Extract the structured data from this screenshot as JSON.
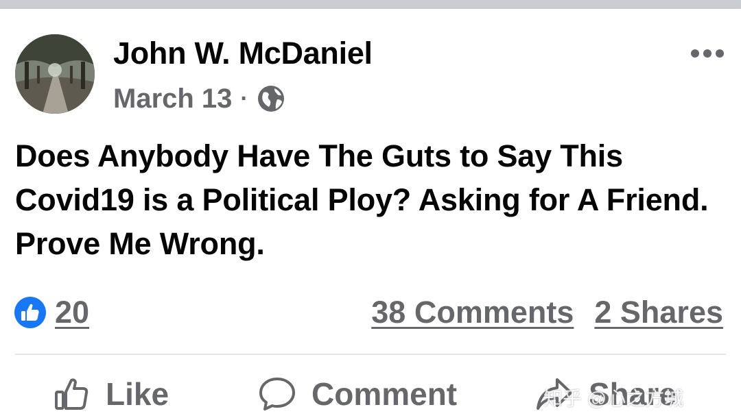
{
  "post": {
    "author": "John W. McDaniel",
    "date": "March 13",
    "separator": "·",
    "privacy_icon": "globe-icon",
    "more_icon": "more-horizontal-icon",
    "text": "Does Anybody Have The Guts to Say This Covid19 is a Political Ploy? Asking for A Friend. Prove Me Wrong."
  },
  "stats": {
    "reaction_icon": "like-reaction-icon",
    "reaction_count": "20",
    "comments": "38 Comments",
    "shares": "2 Shares"
  },
  "actions": {
    "like_label": "Like",
    "like_icon": "thumbs-up-icon",
    "comment_label": "Comment",
    "comment_icon": "speech-bubble-icon",
    "share_label": "Share",
    "share_icon": "share-arrow-icon"
  },
  "watermark": "知乎 @心之方城",
  "colors": {
    "primary_text": "#050505",
    "secondary_text": "#65676b",
    "like_blue": "#1877f2",
    "divider": "#e4e6eb"
  }
}
